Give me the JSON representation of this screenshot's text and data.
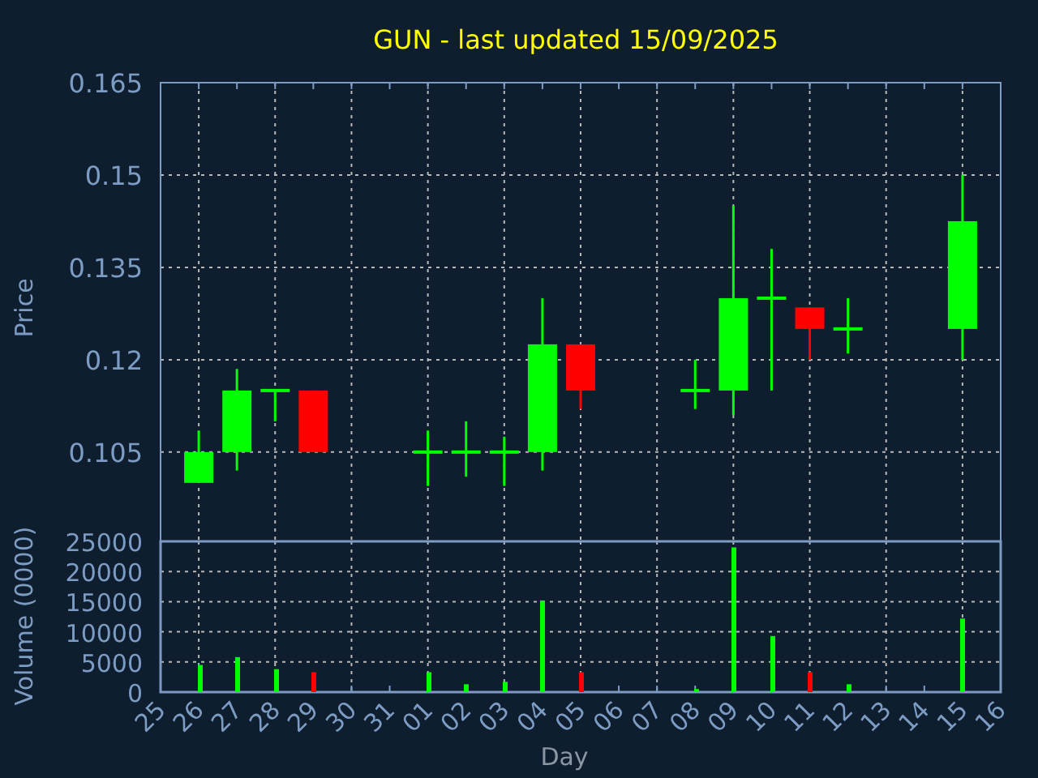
{
  "title": "GUN - last updated 15/09/2025",
  "price_chart": {
    "chart_data": {
      "type": "candlestick",
      "ylabel": "Price",
      "grid": true,
      "categories": [
        null,
        null,
        null,
        null,
        null,
        null,
        null,
        null,
        null,
        null,
        null,
        null,
        null,
        null,
        null,
        null,
        null,
        null,
        null,
        null,
        null,
        null,
        null
      ],
      "ohlc": [
        null,
        [
          0.1,
          0.1085,
          0.1,
          0.105
        ],
        [
          0.105,
          0.1185,
          0.102,
          0.115
        ],
        [
          0.115,
          0.115,
          0.11,
          0.115
        ],
        [
          0.115,
          0.115,
          0.105,
          0.105
        ],
        null,
        null,
        [
          0.105,
          0.1085,
          0.0995,
          0.105
        ],
        [
          0.105,
          0.11,
          0.101,
          0.105
        ],
        [
          0.105,
          0.1075,
          0.0995,
          0.105
        ],
        [
          0.105,
          0.13,
          0.102,
          0.1225
        ],
        [
          0.1225,
          0.1225,
          0.112,
          0.115
        ],
        null,
        null,
        [
          0.115,
          0.12,
          0.112,
          0.115
        ],
        [
          0.115,
          0.145,
          0.111,
          0.13
        ],
        [
          0.13,
          0.138,
          0.115,
          0.13
        ],
        [
          0.1285,
          0.1285,
          0.12,
          0.125
        ],
        [
          0.125,
          0.13,
          0.121,
          0.125
        ],
        null,
        null,
        [
          0.125,
          0.15,
          0.12,
          0.1425
        ],
        null
      ],
      "ylim": [
        0.0905,
        0.165
      ],
      "yticks": [
        {
          "value": 0.105,
          "label": "0.105"
        },
        {
          "value": 0.12,
          "label": "0.12"
        },
        {
          "value": 0.135,
          "label": "0.135"
        },
        {
          "value": 0.15,
          "label": "0.15"
        },
        {
          "value": 0.165,
          "label": "0.165"
        }
      ]
    }
  },
  "volume_chart": {
    "chart_data": {
      "type": "bar",
      "xlabel": "Day",
      "ylabel": "Volume (0000)",
      "grid": true,
      "categories": [
        "25",
        "26",
        "27",
        "28",
        "29",
        "30",
        "31",
        "01",
        "02",
        "03",
        "04",
        "05",
        "06",
        "07",
        "08",
        "09",
        "10",
        "11",
        "12",
        "13",
        "14",
        "15",
        "16"
      ],
      "values": [
        null,
        4500,
        5800,
        3800,
        3300,
        null,
        null,
        3300,
        1300,
        1700,
        15200,
        3300,
        null,
        null,
        500,
        24000,
        9300,
        3300,
        1300,
        null,
        null,
        12200,
        null
      ],
      "ylim": [
        0,
        25000
      ],
      "yticks": [
        0,
        5000,
        10000,
        15000,
        20000,
        25000
      ]
    }
  }
}
